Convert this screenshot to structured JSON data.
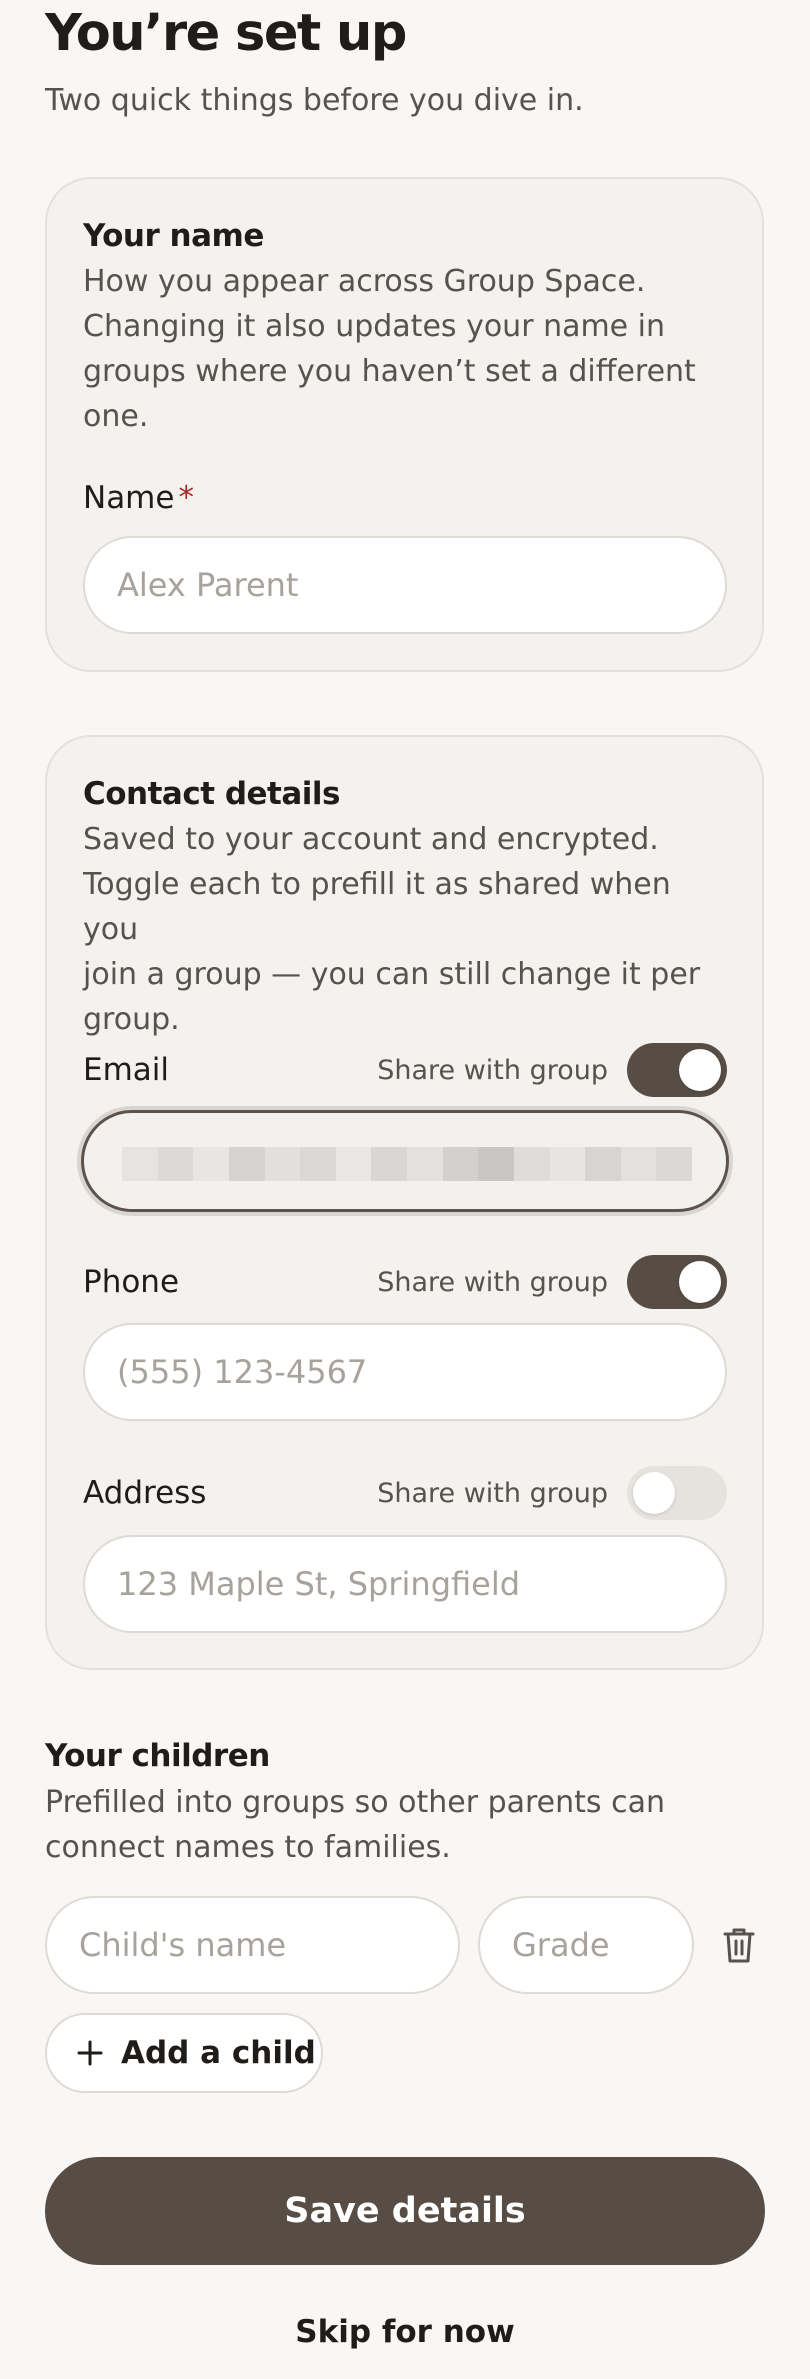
{
  "header": {
    "title": "You’re set up",
    "subtitle": "Two quick things before you dive in."
  },
  "name_section": {
    "title": "Your name",
    "description": "How you appear across Group Space.\nChanging it also updates your name in\ngroups where you haven’t set a different\none.",
    "field_label": "Name",
    "required_mark": "*",
    "placeholder": "Alex Parent",
    "value": ""
  },
  "contact_section": {
    "title": "Contact details",
    "description": "Saved to your account and encrypted.\nToggle each to prefill it as shared when you\njoin a group — you can still change it per\ngroup.",
    "fields": [
      {
        "label": "Email",
        "share_label": "Share with group",
        "shared": true,
        "value_obscured": true
      },
      {
        "label": "Phone",
        "share_label": "Share with group",
        "shared": true,
        "placeholder": "(555) 123-4567"
      },
      {
        "label": "Address",
        "share_label": "Share with group",
        "shared": false,
        "placeholder": "123 Maple St, Springfield"
      }
    ]
  },
  "children_section": {
    "title": "Your children",
    "description": "Prefilled into groups so other parents can\nconnect names to families.",
    "child_name_placeholder": "Child's name",
    "grade_placeholder": "Grade",
    "add_child_label": "Add a child"
  },
  "actions": {
    "save_label": "Save details",
    "skip_label": "Skip for now"
  },
  "colors": {
    "accent": "#574d45",
    "required": "#a72b2b",
    "background": "#f8f7f5"
  },
  "icons": {
    "trash": "trash-icon",
    "plus": "plus-icon"
  }
}
